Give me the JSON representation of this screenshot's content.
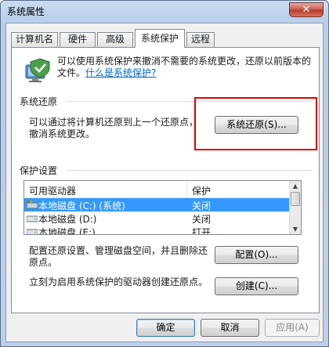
{
  "window": {
    "title": "系统属性",
    "close_label": "✕"
  },
  "tabs": [
    {
      "label": "计算机名"
    },
    {
      "label": "硬件"
    },
    {
      "label": "高级"
    },
    {
      "label": "系统保护"
    },
    {
      "label": "远程"
    }
  ],
  "active_tab": "系统保护",
  "intro": {
    "text": "可以使用系统保护来撤消不需要的系统更改，还原以前版本的文件。",
    "link": "什么是系统保护?"
  },
  "restore": {
    "section_label": "系统还原",
    "description_line1": "可以通过将计算机还原到上一个还原点，",
    "description_line2": "撤消系统更改。",
    "button": "系统还原(S)..."
  },
  "protection": {
    "section_label": "保护设置",
    "columns": [
      "可用驱动器",
      "保护"
    ],
    "rows": [
      {
        "drive": "本地磁盘 (C:) (系统)",
        "protection": "关闭",
        "selected": true
      },
      {
        "drive": "本地磁盘 (D:)",
        "protection": "关闭",
        "selected": false
      },
      {
        "drive": "本地磁盘 (E:)",
        "protection": "打开",
        "selected": false
      }
    ]
  },
  "configure": {
    "text_line1": "配置还原设置、管理磁盘空间，并且删除还",
    "text_line2": "原点。",
    "button": "配置(O)..."
  },
  "create": {
    "text": "立刻为启用系统保护的驱动器创建还原点。",
    "button": "创建(C)..."
  },
  "footer": {
    "ok": "确定",
    "cancel": "取消",
    "apply": "应用(A)"
  },
  "colors": {
    "selection": "#3399ff",
    "link": "#0066cc",
    "highlight_box": "#e00000"
  }
}
